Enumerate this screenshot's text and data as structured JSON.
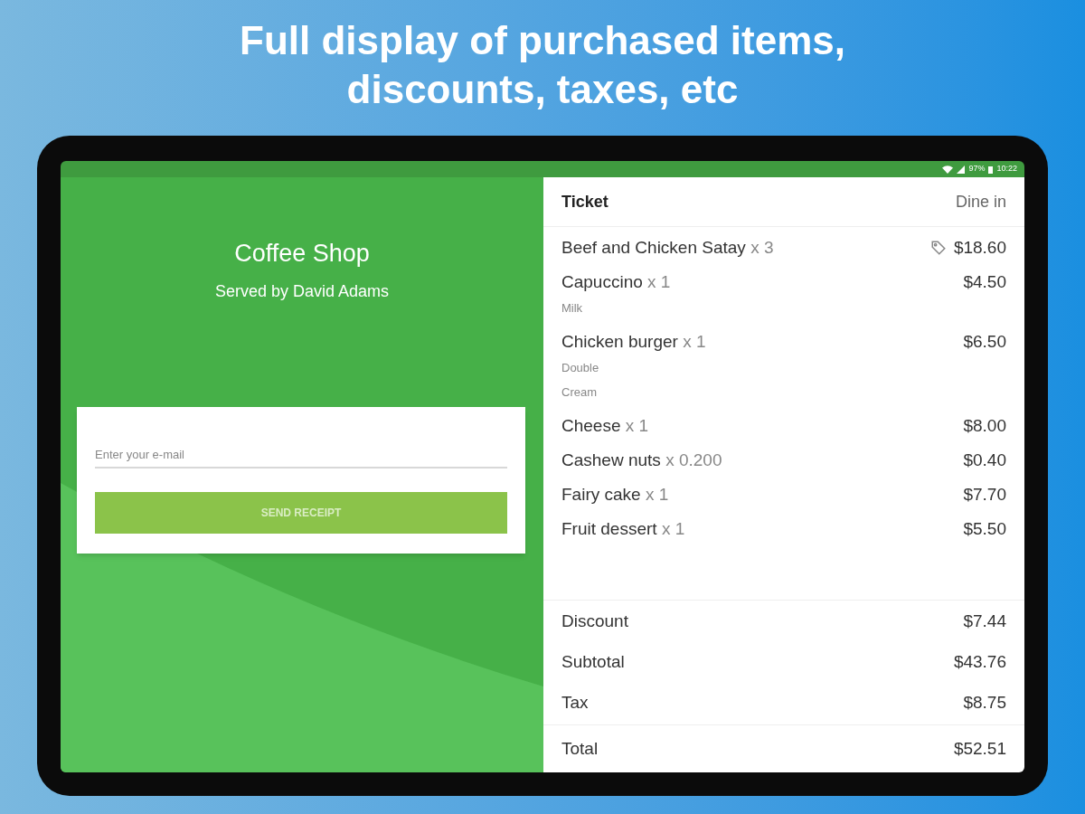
{
  "headline": [
    "Full display of purchased items,",
    "discounts, taxes, etc"
  ],
  "status_bar": {
    "battery": "97%",
    "time": "10:22"
  },
  "shop": {
    "name": "Coffee Shop",
    "served_by": "Served by David Adams"
  },
  "receipt_form": {
    "email": {
      "placeholder": "Enter your e-mail"
    },
    "send_button": {
      "label": "SEND RECEIPT",
      "disabled": true
    }
  },
  "ticket": {
    "title": "Ticket",
    "order_type": "Dine in",
    "items": [
      {
        "name": "Beef and Chicken Satay",
        "qty": "x 3",
        "price": "$18.60",
        "discounted": true
      },
      {
        "name": "Capuccino",
        "qty": "x 1",
        "modifiers": [
          "Milk"
        ],
        "price": "$4.50",
        "discounted": false
      },
      {
        "name": "Chicken burger",
        "qty": "x 1",
        "modifiers": [
          "Double",
          "Cream"
        ],
        "price": "$6.50",
        "discounted": false
      },
      {
        "name": "Cheese",
        "qty": "x 1",
        "price": "$8.00",
        "discounted": false
      },
      {
        "name": "Cashew nuts",
        "qty": "x 0.200",
        "price": "$0.40",
        "discounted": false
      },
      {
        "name": "Fairy cake",
        "qty": "x 1",
        "price": "$7.70",
        "discounted": false
      },
      {
        "name": "Fruit dessert",
        "qty": "x 1",
        "price": "$5.50",
        "discounted": false
      }
    ],
    "summary": [
      {
        "label": "Discount",
        "value": "$7.44"
      },
      {
        "label": "Subtotal",
        "value": "$43.76"
      },
      {
        "label": "Tax",
        "value": "$8.75"
      }
    ],
    "total": {
      "label": "Total",
      "value": "$52.51"
    }
  }
}
